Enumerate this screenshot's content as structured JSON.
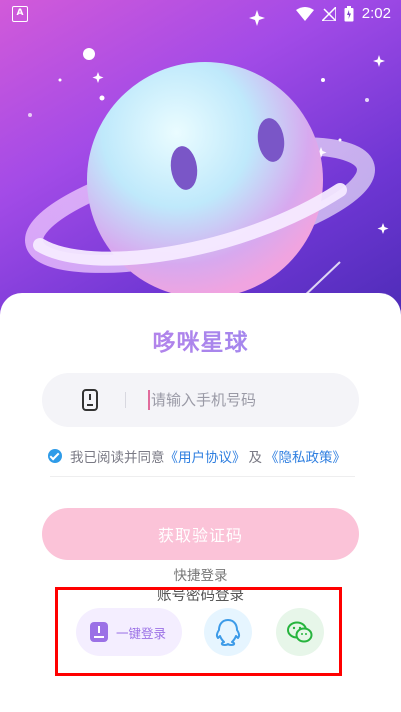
{
  "status_bar": {
    "time": "2:02",
    "left_icon": "A"
  },
  "brand": {
    "title": "哆咪星球"
  },
  "phone": {
    "placeholder": "请输入手机号码",
    "icon": "phone-icon"
  },
  "agreement": {
    "prefix": "我已阅读并同意",
    "user_agreement": "《用户协议》",
    "and": "及",
    "privacy_policy": "《隐私政策》",
    "checked": true
  },
  "actions": {
    "get_code_label": "获取验证码",
    "quick_login_title": "快捷登录",
    "password_login_label": "账号密码登录",
    "one_click_label": "一键登录"
  },
  "colors": {
    "accent_pink": "#fbc3d8",
    "link_blue": "#2f7fe0",
    "check_blue": "#2e9be8",
    "highlight_red": "#ff0000"
  }
}
